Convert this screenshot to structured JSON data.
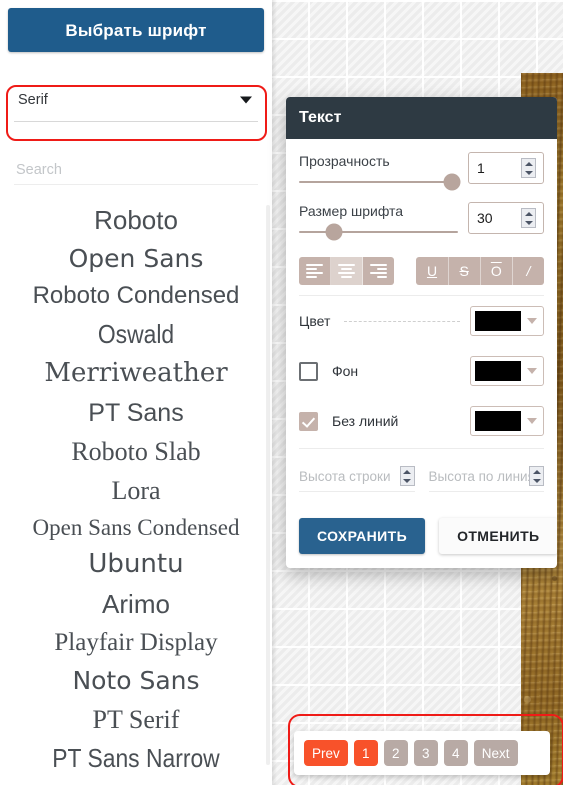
{
  "font_panel": {
    "header_button": "Выбрать шрифт",
    "select": {
      "value": "Serif",
      "caret_icon": "chevron-down-icon"
    },
    "search": {
      "placeholder": "Search",
      "value": ""
    },
    "fonts": [
      {
        "name": "Roboto",
        "class": "f-sans",
        "size": 26
      },
      {
        "name": "Open Sans",
        "class": "f-dvs",
        "size": 25
      },
      {
        "name": "Roboto Condensed",
        "class": "f-sans",
        "size": 24
      },
      {
        "name": "Oswald",
        "class": "f-cond",
        "size": 26
      },
      {
        "name": "Merriweather",
        "class": "f-dvserif",
        "size": 26
      },
      {
        "name": "PT Sans",
        "class": "f-sans",
        "size": 25
      },
      {
        "name": "Roboto Slab",
        "class": "f-serif",
        "size": 26
      },
      {
        "name": "Lora",
        "class": "f-serif",
        "size": 26
      },
      {
        "name": "Open Sans Condensed",
        "class": "f-serif",
        "size": 23
      },
      {
        "name": "Ubuntu",
        "class": "f-dvs",
        "size": 26
      },
      {
        "name": "Arimo",
        "class": "f-sans",
        "size": 26
      },
      {
        "name": "Playfair Display",
        "class": "f-serif",
        "size": 25
      },
      {
        "name": "Noto Sans",
        "class": "f-dvs",
        "size": 25
      },
      {
        "name": "PT Serif",
        "class": "f-serif",
        "size": 26
      },
      {
        "name": "PT Sans Narrow",
        "class": "f-cond",
        "size": 26
      }
    ]
  },
  "dialog": {
    "title": "Текст",
    "opacity": {
      "label": "Прозрачность",
      "value": "1",
      "slider_percent": 96
    },
    "font_size": {
      "label": "Размер шрифта",
      "value": "30",
      "slider_percent": 22
    },
    "align_buttons": [
      {
        "name": "align-left",
        "icon": "align-left-icon",
        "active": false
      },
      {
        "name": "align-center",
        "icon": "align-center-icon",
        "active": true
      },
      {
        "name": "align-right",
        "icon": "align-right-icon",
        "active": false
      }
    ],
    "style_buttons": [
      {
        "label": "U",
        "name": "underline",
        "icon": "underline-icon",
        "active": false
      },
      {
        "label": "S",
        "name": "strikethrough",
        "icon": "strikethrough-icon",
        "active": false
      },
      {
        "label": "O",
        "name": "overline",
        "icon": "overline-icon",
        "active": false
      },
      {
        "label": "/",
        "name": "italic",
        "icon": "italic-icon",
        "active": false
      }
    ],
    "color_row": {
      "label": "Цвет",
      "swatch": "#000000"
    },
    "background_row": {
      "label": "Фон",
      "checked": false,
      "swatch": "#000000"
    },
    "nolines_row": {
      "label": "Без линий",
      "checked": true,
      "swatch": "#000000"
    },
    "line_height": {
      "placeholder": "Высота строки",
      "value": ""
    },
    "line_height_by_lines": {
      "placeholder": "Высота по линиям",
      "value": ""
    },
    "save_button": "СОХРАНИТЬ",
    "cancel_button": "ОТМЕНИТЬ"
  },
  "pagination": {
    "prev": "Prev",
    "pages": [
      "1",
      "2",
      "3",
      "4"
    ],
    "active_page": "1",
    "next": "Next"
  },
  "colors": {
    "header_blue": "#1f5c8c",
    "dialog_header": "#2e3a43",
    "accent_tan": "#c5b2ab",
    "pager_active": "#f8522a",
    "pager_idle": "#b8aaa5",
    "highlight_red": "#ef1b17"
  }
}
